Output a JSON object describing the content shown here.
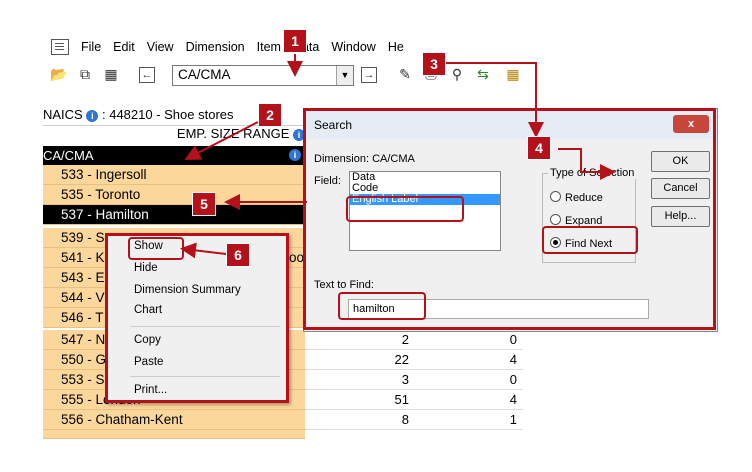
{
  "menubar": {
    "items": [
      "File",
      "Edit",
      "View",
      "Dimension",
      "Item",
      "Data",
      "Window",
      "He"
    ]
  },
  "toolbar": {
    "combo_value": "CA/CMA"
  },
  "table": {
    "naics_label": "NAICS",
    "naics_value": ": 448210 - Shoe stores",
    "emp_header": "EMP. SIZE RANGE",
    "dimension_header": "CA/CMA",
    "rows": [
      {
        "label": "533 - Ingersoll",
        "a": "",
        "b": ""
      },
      {
        "label": "535 - Toronto",
        "a": "",
        "b": ""
      },
      {
        "label": "537 - Hamilton",
        "a": "",
        "b": ""
      },
      {
        "label": "539 - S",
        "a": "",
        "b": ""
      },
      {
        "label": "541 - K",
        "a": "",
        "b": ""
      },
      {
        "label": "543 - E",
        "a": "",
        "b": ""
      },
      {
        "label": "544 - V",
        "a": "",
        "b": ""
      },
      {
        "label": "546 - T",
        "a": "",
        "b": ""
      },
      {
        "label": "547 - N",
        "a": "2",
        "b": "0"
      },
      {
        "label": "550 - G",
        "a": "22",
        "b": "4"
      },
      {
        "label": "553 - S",
        "a": "3",
        "b": "0"
      },
      {
        "label": "555 - London",
        "a": "51",
        "b": "4"
      },
      {
        "label": "556 - Chatham-Kent",
        "a": "8",
        "b": "1"
      }
    ],
    "row541_tail": "oo"
  },
  "dialog": {
    "title": "Search",
    "close": "x",
    "dimension_label": "Dimension: CA/CMA",
    "field_label": "Field:",
    "field_options": [
      "Data",
      "Code",
      "English Label"
    ],
    "field_selected": "English Label",
    "type_title": "Type of Selection",
    "type_options": [
      "Reduce",
      "Expand",
      "Find Next"
    ],
    "type_selected": "Find Next",
    "text_to_find_label": "Text to Find:",
    "text_to_find_value": "hamilton",
    "buttons": {
      "ok": "OK",
      "cancel": "Cancel",
      "help": "Help..."
    }
  },
  "context_menu": {
    "items": [
      "Show",
      "Hide",
      "Dimension Summary",
      "Chart",
      "Copy",
      "Paste",
      "Print..."
    ]
  },
  "callouts": [
    "1",
    "2",
    "3",
    "4",
    "5",
    "6"
  ],
  "colors": {
    "accent": "#b5111b",
    "row_bg": "#fcd79b",
    "selection": "#3399ff"
  }
}
